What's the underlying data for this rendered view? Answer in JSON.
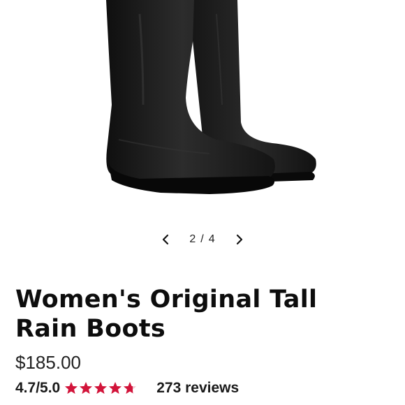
{
  "carousel": {
    "current": "2",
    "separator": "/",
    "total": "4"
  },
  "product": {
    "title_line1": "Women's Original Tall",
    "title_line2": "Rain Boots",
    "price": "$185.00",
    "rating": "4.7/5.0",
    "stars_count": 4.7,
    "reviews": "273 reviews"
  },
  "colors": {
    "star": "#d2143a",
    "boot": "#1b1b1b"
  },
  "icons": {
    "prev": "chevron-left-icon",
    "next": "chevron-right-icon",
    "star": "star-icon"
  }
}
